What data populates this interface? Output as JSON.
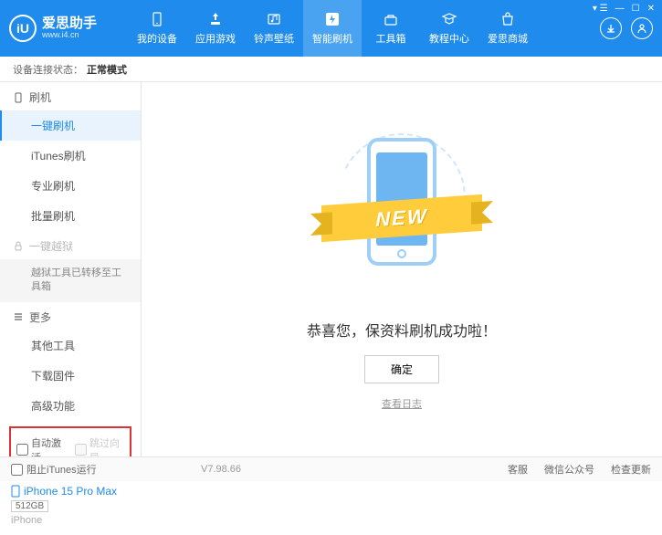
{
  "app": {
    "title": "爱思助手",
    "url": "www.i4.cn",
    "logo_letter": "iU"
  },
  "nav": [
    {
      "label": "我的设备",
      "icon": "device"
    },
    {
      "label": "应用游戏",
      "icon": "apps"
    },
    {
      "label": "铃声壁纸",
      "icon": "ringtone"
    },
    {
      "label": "智能刷机",
      "icon": "flash",
      "active": true
    },
    {
      "label": "工具箱",
      "icon": "toolbox"
    },
    {
      "label": "教程中心",
      "icon": "tutorial"
    },
    {
      "label": "爱思商城",
      "icon": "store"
    }
  ],
  "status": {
    "prefix": "设备连接状态：",
    "mode": "正常模式"
  },
  "sidebar": {
    "group_flash": "刷机",
    "items_flash": [
      "一键刷机",
      "iTunes刷机",
      "专业刷机",
      "批量刷机"
    ],
    "group_jailbreak": "一键越狱",
    "jailbreak_note": "越狱工具已转移至工具箱",
    "group_more": "更多",
    "items_more": [
      "其他工具",
      "下载固件",
      "高级功能"
    ],
    "checkbox_auto_activate": "自动激活",
    "checkbox_skip_guide": "跳过向导"
  },
  "device": {
    "name": "iPhone 15 Pro Max",
    "storage": "512GB",
    "type": "iPhone"
  },
  "main": {
    "ribbon": "NEW",
    "success_text": "恭喜您，保资料刷机成功啦！",
    "confirm": "确定",
    "view_log": "查看日志"
  },
  "footer": {
    "block_itunes": "阻止iTunes运行",
    "version": "V7.98.66",
    "links": [
      "客服",
      "微信公众号",
      "检查更新"
    ]
  }
}
